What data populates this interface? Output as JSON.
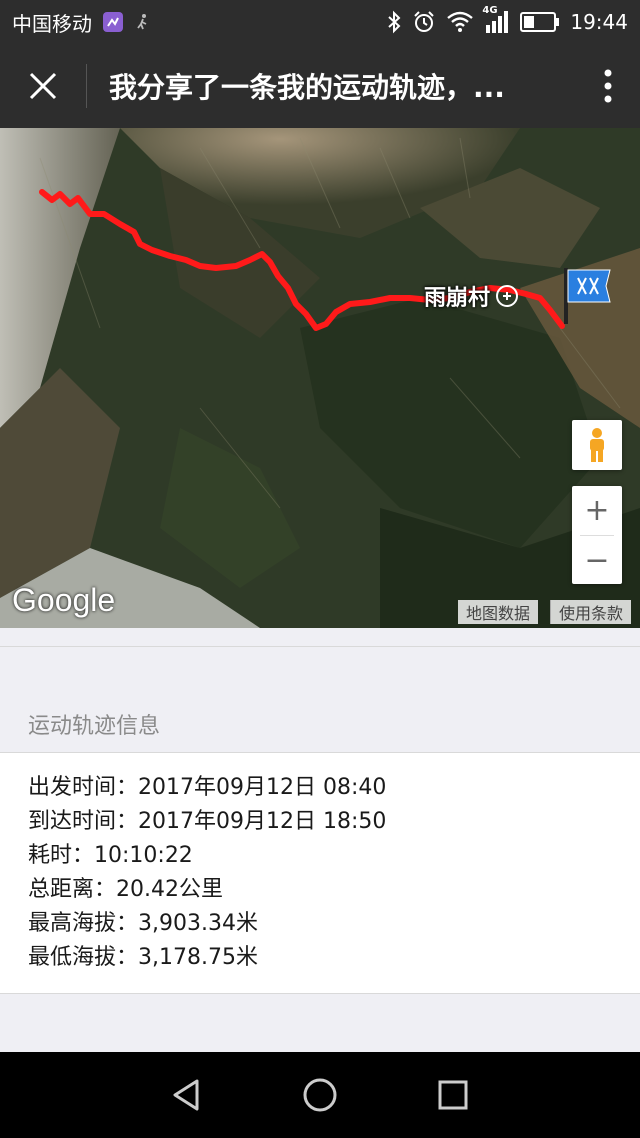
{
  "status_bar": {
    "carrier": "中国移动",
    "network": "4G",
    "time": "19:44",
    "icons": [
      "app-notification-icon",
      "walk-icon",
      "bluetooth-icon",
      "alarm-icon",
      "wifi-icon",
      "signal-icon",
      "battery-icon"
    ]
  },
  "title_bar": {
    "title": "我分享了一条我的运动轨迹，...",
    "close_icon": "close-icon",
    "more_icon": "more-vertical-icon"
  },
  "map": {
    "place_label": "雨崩村",
    "logo": "Google",
    "footer_data": "地图数据",
    "footer_terms": "使用条款",
    "zoom_in": "+",
    "zoom_out": "−",
    "track_color": "#ff1a1a"
  },
  "track_info": {
    "section_title": "运动轨迹信息",
    "departure": "出发时间：2017年09月12日 08:40",
    "arrival": "到达时间：2017年09月12日 18:50",
    "duration": "耗时：10:10:22",
    "distance": "总距离：20.42公里",
    "max_altitude": "最高海拔：3,903.34米",
    "min_altitude": "最低海拔：3,178.75米"
  },
  "nav_bar": {
    "back": "back-icon",
    "home": "home-icon",
    "recents": "recents-icon"
  }
}
